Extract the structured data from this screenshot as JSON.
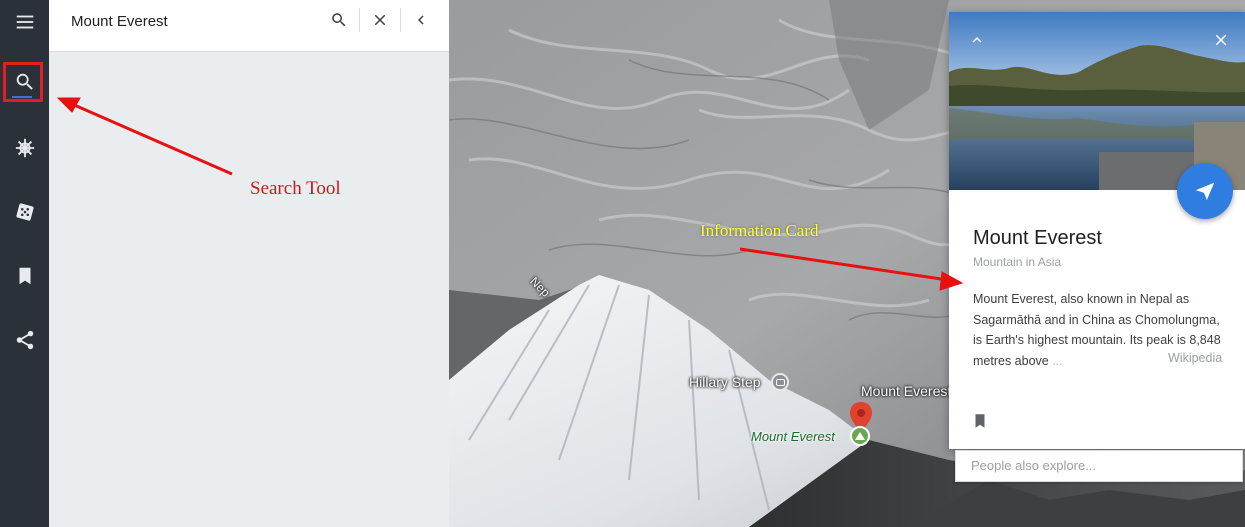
{
  "rail": {
    "items": [
      {
        "name": "menu",
        "icon": "menu-icon"
      },
      {
        "name": "search",
        "icon": "search-icon",
        "active": true
      },
      {
        "name": "voyager",
        "icon": "ship-wheel-icon"
      },
      {
        "name": "feeling-lucky",
        "icon": "dice-icon"
      },
      {
        "name": "my-places",
        "icon": "bookmark-icon"
      },
      {
        "name": "share",
        "icon": "share-icon"
      }
    ],
    "active_highlight_color": "#e02020"
  },
  "search": {
    "value": "Mount Everest",
    "buttons": [
      "search-icon",
      "close-icon",
      "chevron-left-icon"
    ]
  },
  "map": {
    "labels": {
      "nepal_partial": "Nep",
      "hillary_step": "Hillary Step",
      "mount_everest_white": "Mount Everest",
      "mount_everest_green": "Mount Everest"
    },
    "pin_color": "#e2412d"
  },
  "annotations": {
    "search_tool": "Search Tool",
    "information_card": "Information Card",
    "arrow_color": "#e81010"
  },
  "card": {
    "title": "Mount Everest",
    "subtitle": "Mountain in Asia",
    "description": "Mount Everest, also known in Nepal as Sagarmāthā and in China as Chomolungma, is Earth's highest mountain. Its peak is 8,848 metres above",
    "description_fade": " ...",
    "source_link": "Wikipedia",
    "fab_color": "#2f7de1",
    "buttons": [
      "chevron-up-icon",
      "close-icon",
      "send-icon",
      "bookmark-icon"
    ]
  },
  "explore": {
    "placeholder": "People also explore..."
  }
}
